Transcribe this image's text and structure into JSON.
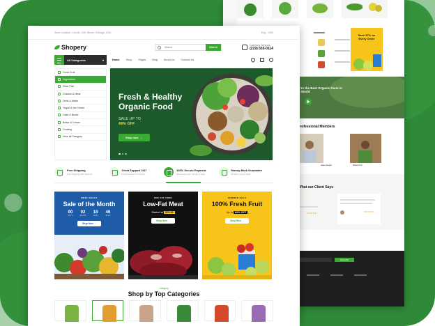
{
  "topbar": {
    "address": "Store Location: Lincoln- 344, Illinois, Chicago, USA",
    "lang": "Eng",
    "currency": "USD"
  },
  "header": {
    "logo": "Shopery",
    "search_placeholder": "Search",
    "search_button": "Search",
    "support_label": "Customer Services",
    "support_phone": "(219) 555-0114"
  },
  "nav": {
    "categories": "All Categories",
    "links": [
      "Home",
      "Shop",
      "Pages",
      "Blog",
      "About Us",
      "Contact Us"
    ]
  },
  "sidebar": {
    "items": [
      "Fresh Fruit",
      "Vegetables",
      "River Fish",
      "Chicken & Meat",
      "Drink & Water",
      "Yogurt & Ice Cream",
      "Cake & Bread",
      "Butter & Cream",
      "Cooking",
      "View all Category"
    ]
  },
  "hero": {
    "title": "Fresh & Healthy Organic Food",
    "sale_prefix": "SALE UP TO",
    "sale_value": "48% OFF",
    "button": "Shop now"
  },
  "features": [
    {
      "title": "Free Shipping",
      "sub": "Free shipping with discount"
    },
    {
      "title": "Great Support 24/7",
      "sub": "Instant access to Contact"
    },
    {
      "title": "100% Secure Payment",
      "sub": "We ensure your money is save"
    },
    {
      "title": "Money-Back Guarantee",
      "sub": "30 days money-back"
    }
  ],
  "promos": [
    {
      "tag": "BEST DEALS",
      "title": "Sale of the Month",
      "countdown": [
        {
          "value": "00",
          "label": "DAYS"
        },
        {
          "value": "02",
          "label": "HOURS"
        },
        {
          "value": "18",
          "label": "MINS"
        },
        {
          "value": "46",
          "label": "SECS"
        }
      ],
      "button": "Shop Now"
    },
    {
      "tag": "85% FAT FREE",
      "title": "Low-Fat Meat",
      "sub_prefix": "Started at",
      "price": "$79.99",
      "button": "Shop Now"
    },
    {
      "tag": "SUMMER SALE",
      "title": "100% Fresh Fruit",
      "sub_prefix": "Up to",
      "price": "64% OFF",
      "button": "Shop Now"
    }
  ],
  "shopby": {
    "tag": "Category",
    "title": "Shop by Top Categories"
  },
  "back_page": {
    "promo": "Save 37% on Every Order",
    "video_title": "We're the Best Organic Farm in the World",
    "team_title": "Professional Members",
    "testimonials_title": "What our Client Says",
    "newsletter_button": "Subscribe",
    "member_names": [
      "Jenny Wilson",
      "Jane Cooper",
      "Robert Fox"
    ],
    "rating": "★★★★★"
  },
  "colors": {
    "brand_green": "#3aaa35",
    "frame_green": "#2f8a38",
    "hero_dark": "#1d5a2b",
    "promo_blue": "#1f5ca8",
    "promo_yellow": "#f8c419"
  }
}
